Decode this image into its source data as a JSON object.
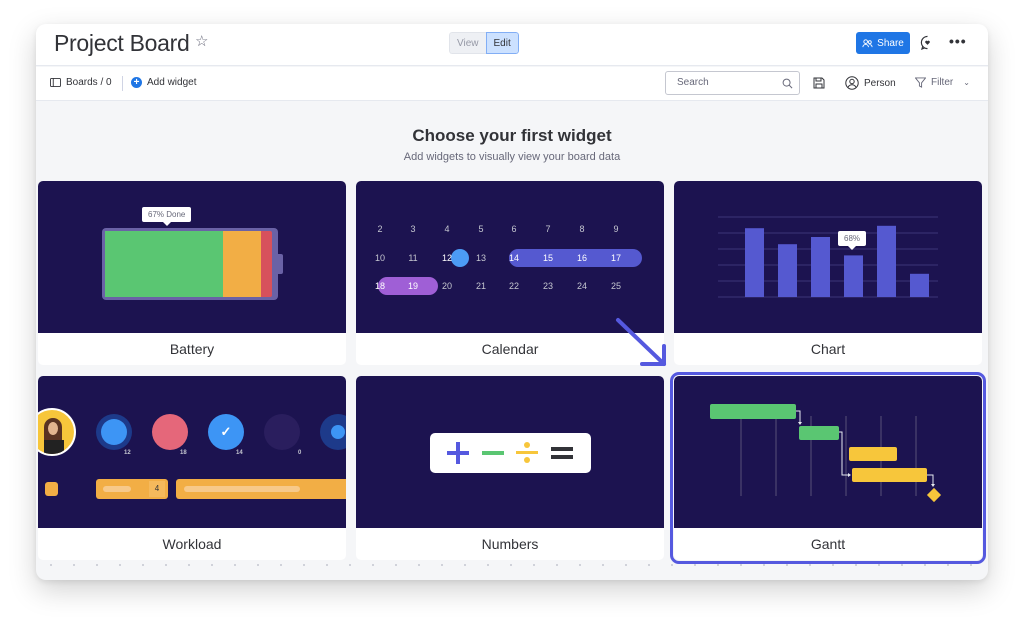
{
  "header": {
    "title": "Project Board",
    "view_label": "View",
    "edit_label": "Edit",
    "share_label": "Share"
  },
  "toolbar": {
    "boards_label": "Boards / 0",
    "add_widget_label": "Add widget",
    "search_placeholder": "Search",
    "person_label": "Person",
    "filter_label": "Filter"
  },
  "main": {
    "heading": "Choose your first widget",
    "subheading": "Add widgets to visually view your board data"
  },
  "widgets": [
    {
      "label": "Battery",
      "tooltip": "67% Done",
      "segments": {
        "done": 0.67,
        "working": 0.22,
        "stuck": 0.06
      },
      "colors": {
        "done": "#5ac672",
        "working": "#f2ae45",
        "stuck": "#d7515c"
      }
    },
    {
      "label": "Calendar",
      "rows": [
        [
          "2",
          "3",
          "4",
          "5",
          "6",
          "7",
          "8",
          "9"
        ],
        [
          "10",
          "11",
          "12",
          "13",
          "14",
          "15",
          "16",
          "17"
        ],
        [
          "18",
          "19",
          "20",
          "21",
          "22",
          "23",
          "24",
          "25"
        ]
      ],
      "highlight_day": "12",
      "range_blue": [
        "14",
        "15",
        "16",
        "17"
      ],
      "range_purple": [
        "18",
        "19"
      ]
    },
    {
      "label": "Chart",
      "tooltip": "68%",
      "bar_values": [
        0.86,
        0.66,
        0.75,
        0.52,
        0.89,
        0.29
      ]
    },
    {
      "label": "Workload",
      "counts": [
        "12",
        "18",
        "14",
        "0"
      ],
      "bar_value": "4"
    },
    {
      "label": "Numbers",
      "symbols": [
        "+",
        "−",
        "÷",
        "="
      ]
    },
    {
      "label": "Gantt",
      "selected": true
    }
  ],
  "colors": {
    "accent": "#1f76e5",
    "widget_bg": "#1c1350",
    "selection": "#5559df",
    "chart_bar": "#5559d0"
  }
}
